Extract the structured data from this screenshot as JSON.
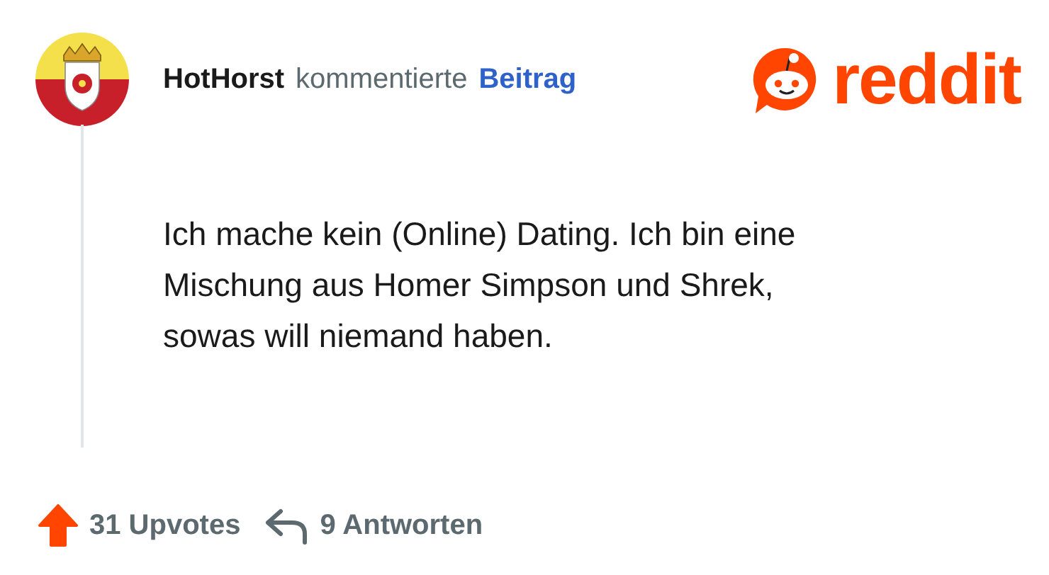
{
  "comment": {
    "author": "HotHorst",
    "action": "kommentierte",
    "target": "Beitrag",
    "body": [
      "Ich mache kein (Online) Dating. Ich bin eine",
      "Mischung aus Homer Simpson und Shrek,",
      "sowas will niemand haben."
    ],
    "upvoted": true,
    "upvotes": "31 Upvotes",
    "replies": "9 Antworten"
  },
  "logo": {
    "text": "reddit"
  }
}
